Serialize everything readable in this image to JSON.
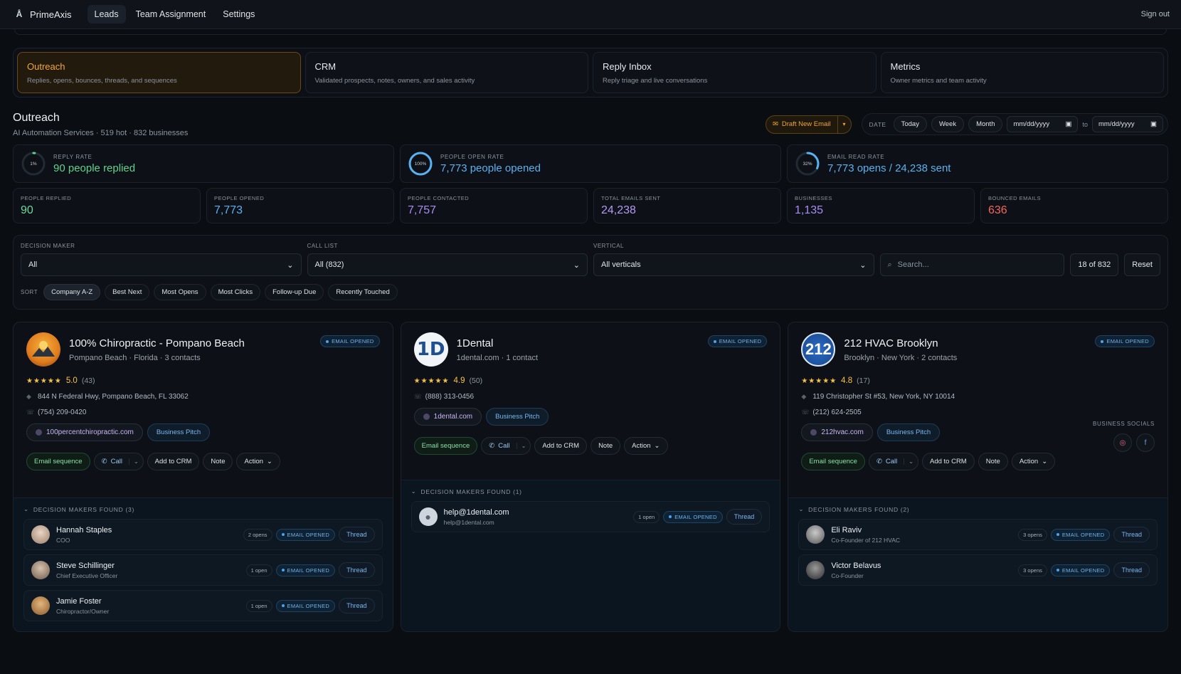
{
  "app": {
    "name": "PrimeAxis",
    "nav": [
      "Leads",
      "Team Assignment",
      "Settings"
    ],
    "sign_out": "Sign out"
  },
  "tabs": [
    {
      "title": "Outreach",
      "sub": "Replies, opens, bounces, threads, and sequences"
    },
    {
      "title": "CRM",
      "sub": "Validated prospects, notes, owners, and sales activity"
    },
    {
      "title": "Reply Inbox",
      "sub": "Reply triage and live conversations"
    },
    {
      "title": "Metrics",
      "sub": "Owner metrics and team activity"
    }
  ],
  "outreach": {
    "title": "Outreach",
    "subtitle": "AI Automation Services · 519 hot · 832 businesses",
    "draft_label": "Draft New Email",
    "date_label": "DATE",
    "date_pills": [
      "Today",
      "Week",
      "Month"
    ],
    "date_from": "mm/dd/yyyy",
    "date_to_label": "to",
    "date_to": "mm/dd/yyyy"
  },
  "big_stats": [
    {
      "label": "REPLY RATE",
      "value": "90 people replied",
      "ring": "1%",
      "pct": 0.01,
      "color": "#5fd38a"
    },
    {
      "label": "PEOPLE OPEN RATE",
      "value": "7,773 people opened",
      "ring": "100%",
      "pct": 1.0,
      "color": "#5ab1f0"
    },
    {
      "label": "EMAIL READ RATE",
      "value": "7,773 opens / 24,238 sent",
      "ring": "32%",
      "pct": 0.32,
      "color": "#5ab1f0"
    }
  ],
  "small_stats": [
    {
      "label": "PEOPLE REPLIED",
      "value": "90",
      "color": "#6ed89a"
    },
    {
      "label": "PEOPLE OPENED",
      "value": "7,773",
      "color": "#5ab1f0"
    },
    {
      "label": "PEOPLE CONTACTED",
      "value": "7,757",
      "color": "#a98cf3"
    },
    {
      "label": "TOTAL EMAILS SENT",
      "value": "24,238",
      "color": "#b49af5"
    },
    {
      "label": "BUSINESSES",
      "value": "1,135",
      "color": "#a98cf3"
    },
    {
      "label": "BOUNCED EMAILS",
      "value": "636",
      "color": "#f2665f"
    }
  ],
  "filters": {
    "decision_maker_label": "DECISION MAKER",
    "decision_maker": "All",
    "call_list_label": "CALL LIST",
    "call_list": "All (832)",
    "vertical_label": "VERTICAL",
    "vertical": "All verticals",
    "search_placeholder": "Search...",
    "count": "18 of 832",
    "reset": "Reset",
    "sort_label": "SORT",
    "sorts": [
      "Company A-Z",
      "Best Next",
      "Most Opens",
      "Most Clicks",
      "Follow-up Due",
      "Recently Touched"
    ]
  },
  "labels": {
    "email_opened": "EMAIL OPENED",
    "email_sequence": "Email sequence",
    "call": "Call",
    "add_crm": "Add to CRM",
    "note": "Note",
    "action": "Action",
    "pitch": "Business Pitch",
    "thread": "Thread",
    "socials": "BUSINESS SOCIALS"
  },
  "cards": [
    {
      "name": "100% Chiropractic - Pompano Beach",
      "meta": "Pompano Beach · Florida · 3 contacts",
      "rating": "5.0",
      "reviews": "(43)",
      "address": "844 N Federal Hwy, Pompano Beach, FL 33062",
      "phone": "(754) 209-0420",
      "website": "100percentchiropractic.com",
      "dm_header": "DECISION MAKERS FOUND (3)",
      "dms": [
        {
          "name": "Hannah Staples",
          "title": "COO",
          "opens": "2 opens"
        },
        {
          "name": "Steve Schillinger",
          "title": "Chief Executive Officer",
          "opens": "1 open"
        },
        {
          "name": "Jamie Foster",
          "title": "Chiropractor/Owner",
          "opens": "1 open"
        }
      ]
    },
    {
      "name": "1Dental",
      "meta": "1dental.com · 1 contact",
      "logo_text": "1D",
      "rating": "4.9",
      "reviews": "(50)",
      "phone": "(888) 313-0456",
      "website": "1dental.com",
      "dm_header": "DECISION MAKERS FOUND (1)",
      "dms": [
        {
          "name": "help@1dental.com",
          "title": "help@1dental.com",
          "opens": "1 open"
        }
      ]
    },
    {
      "name": "212 HVAC Brooklyn",
      "meta": "Brooklyn · New York · 2 contacts",
      "logo_text": "212",
      "rating": "4.8",
      "reviews": "(17)",
      "address": "119 Christopher St #53, New York, NY 10014",
      "phone": "(212) 624-2505",
      "website": "212hvac.com",
      "dm_header": "DECISION MAKERS FOUND (2)",
      "dms": [
        {
          "name": "Eli Raviv",
          "title": "Co-Founder of 212 HVAC",
          "opens": "3 opens"
        },
        {
          "name": "Victor Belavus",
          "title": "Co-Founder",
          "opens": "3 opens"
        }
      ]
    }
  ]
}
